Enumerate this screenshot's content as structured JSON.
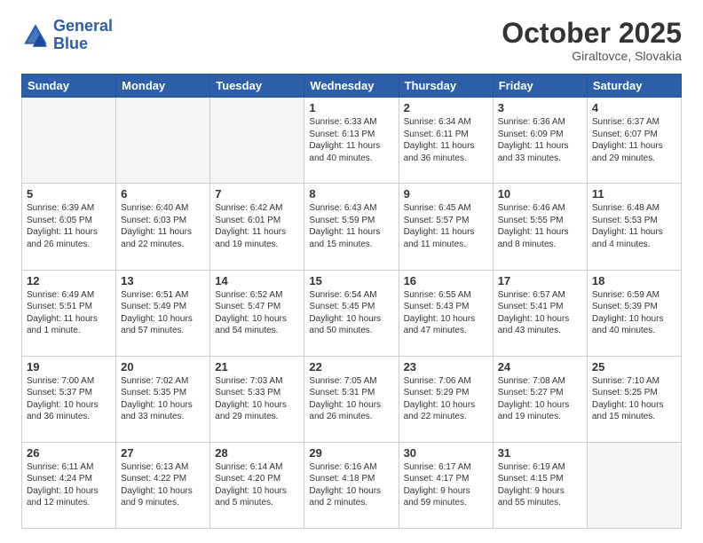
{
  "header": {
    "logo_line1": "General",
    "logo_line2": "Blue",
    "month": "October 2025",
    "location": "Giraltovce, Slovakia"
  },
  "weekdays": [
    "Sunday",
    "Monday",
    "Tuesday",
    "Wednesday",
    "Thursday",
    "Friday",
    "Saturday"
  ],
  "weeks": [
    [
      {
        "day": "",
        "info": ""
      },
      {
        "day": "",
        "info": ""
      },
      {
        "day": "",
        "info": ""
      },
      {
        "day": "1",
        "info": "Sunrise: 6:33 AM\nSunset: 6:13 PM\nDaylight: 11 hours\nand 40 minutes."
      },
      {
        "day": "2",
        "info": "Sunrise: 6:34 AM\nSunset: 6:11 PM\nDaylight: 11 hours\nand 36 minutes."
      },
      {
        "day": "3",
        "info": "Sunrise: 6:36 AM\nSunset: 6:09 PM\nDaylight: 11 hours\nand 33 minutes."
      },
      {
        "day": "4",
        "info": "Sunrise: 6:37 AM\nSunset: 6:07 PM\nDaylight: 11 hours\nand 29 minutes."
      }
    ],
    [
      {
        "day": "5",
        "info": "Sunrise: 6:39 AM\nSunset: 6:05 PM\nDaylight: 11 hours\nand 26 minutes."
      },
      {
        "day": "6",
        "info": "Sunrise: 6:40 AM\nSunset: 6:03 PM\nDaylight: 11 hours\nand 22 minutes."
      },
      {
        "day": "7",
        "info": "Sunrise: 6:42 AM\nSunset: 6:01 PM\nDaylight: 11 hours\nand 19 minutes."
      },
      {
        "day": "8",
        "info": "Sunrise: 6:43 AM\nSunset: 5:59 PM\nDaylight: 11 hours\nand 15 minutes."
      },
      {
        "day": "9",
        "info": "Sunrise: 6:45 AM\nSunset: 5:57 PM\nDaylight: 11 hours\nand 11 minutes."
      },
      {
        "day": "10",
        "info": "Sunrise: 6:46 AM\nSunset: 5:55 PM\nDaylight: 11 hours\nand 8 minutes."
      },
      {
        "day": "11",
        "info": "Sunrise: 6:48 AM\nSunset: 5:53 PM\nDaylight: 11 hours\nand 4 minutes."
      }
    ],
    [
      {
        "day": "12",
        "info": "Sunrise: 6:49 AM\nSunset: 5:51 PM\nDaylight: 11 hours\nand 1 minute."
      },
      {
        "day": "13",
        "info": "Sunrise: 6:51 AM\nSunset: 5:49 PM\nDaylight: 10 hours\nand 57 minutes."
      },
      {
        "day": "14",
        "info": "Sunrise: 6:52 AM\nSunset: 5:47 PM\nDaylight: 10 hours\nand 54 minutes."
      },
      {
        "day": "15",
        "info": "Sunrise: 6:54 AM\nSunset: 5:45 PM\nDaylight: 10 hours\nand 50 minutes."
      },
      {
        "day": "16",
        "info": "Sunrise: 6:55 AM\nSunset: 5:43 PM\nDaylight: 10 hours\nand 47 minutes."
      },
      {
        "day": "17",
        "info": "Sunrise: 6:57 AM\nSunset: 5:41 PM\nDaylight: 10 hours\nand 43 minutes."
      },
      {
        "day": "18",
        "info": "Sunrise: 6:59 AM\nSunset: 5:39 PM\nDaylight: 10 hours\nand 40 minutes."
      }
    ],
    [
      {
        "day": "19",
        "info": "Sunrise: 7:00 AM\nSunset: 5:37 PM\nDaylight: 10 hours\nand 36 minutes."
      },
      {
        "day": "20",
        "info": "Sunrise: 7:02 AM\nSunset: 5:35 PM\nDaylight: 10 hours\nand 33 minutes."
      },
      {
        "day": "21",
        "info": "Sunrise: 7:03 AM\nSunset: 5:33 PM\nDaylight: 10 hours\nand 29 minutes."
      },
      {
        "day": "22",
        "info": "Sunrise: 7:05 AM\nSunset: 5:31 PM\nDaylight: 10 hours\nand 26 minutes."
      },
      {
        "day": "23",
        "info": "Sunrise: 7:06 AM\nSunset: 5:29 PM\nDaylight: 10 hours\nand 22 minutes."
      },
      {
        "day": "24",
        "info": "Sunrise: 7:08 AM\nSunset: 5:27 PM\nDaylight: 10 hours\nand 19 minutes."
      },
      {
        "day": "25",
        "info": "Sunrise: 7:10 AM\nSunset: 5:25 PM\nDaylight: 10 hours\nand 15 minutes."
      }
    ],
    [
      {
        "day": "26",
        "info": "Sunrise: 6:11 AM\nSunset: 4:24 PM\nDaylight: 10 hours\nand 12 minutes."
      },
      {
        "day": "27",
        "info": "Sunrise: 6:13 AM\nSunset: 4:22 PM\nDaylight: 10 hours\nand 9 minutes."
      },
      {
        "day": "28",
        "info": "Sunrise: 6:14 AM\nSunset: 4:20 PM\nDaylight: 10 hours\nand 5 minutes."
      },
      {
        "day": "29",
        "info": "Sunrise: 6:16 AM\nSunset: 4:18 PM\nDaylight: 10 hours\nand 2 minutes."
      },
      {
        "day": "30",
        "info": "Sunrise: 6:17 AM\nSunset: 4:17 PM\nDaylight: 9 hours\nand 59 minutes."
      },
      {
        "day": "31",
        "info": "Sunrise: 6:19 AM\nSunset: 4:15 PM\nDaylight: 9 hours\nand 55 minutes."
      },
      {
        "day": "",
        "info": ""
      }
    ]
  ]
}
